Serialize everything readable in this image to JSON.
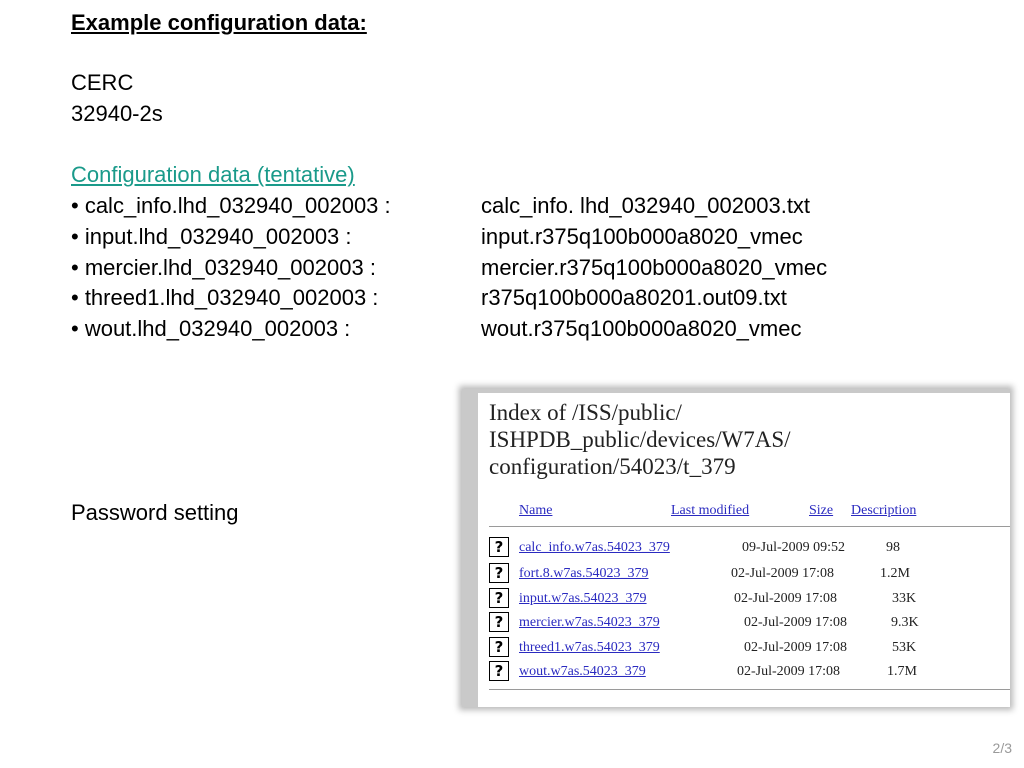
{
  "slide": {
    "heading": "Example configuration data:",
    "line1": "CERC",
    "line2": "32940-2s",
    "config_link": "Configuration data (tentative)",
    "config_items": [
      {
        "left": "• calc_info.lhd_032940_002003   :",
        "right": "calc_info. lhd_032940_002003.txt"
      },
      {
        "left": "• input.lhd_032940_002003 :",
        "right": "input.r375q100b000a8020_vmec"
      },
      {
        "left": "• mercier.lhd_032940_002003 :",
        "right": "mercier.r375q100b000a8020_vmec"
      },
      {
        "left": "• threed1.lhd_032940_002003 :",
        "right": "r375q100b000a80201.out09.txt"
      },
      {
        "left": "• wout.lhd_032940_002003 :",
        "right": "wout.r375q100b000a8020_vmec"
      }
    ],
    "password_label": "Password setting",
    "page_number": "2/3"
  },
  "listing": {
    "title": "Index of /ISS/public/\nISHPDB_public/devices/W7AS/\nconfiguration/54023/t_379",
    "columns": {
      "name": "Name",
      "modified": "Last modified",
      "size": "Size",
      "description": "Description"
    },
    "files": [
      {
        "icon": "unknown-file-icon",
        "name": "calc_info.w7as.54023_379",
        "date": "09-Jul-2009 09:52",
        "size": "98"
      },
      {
        "icon": "unknown-file-icon",
        "name": "fort.8.w7as.54023_379",
        "date": "02-Jul-2009 17:08",
        "size": "1.2M"
      },
      {
        "icon": "unknown-file-icon",
        "name": "input.w7as.54023_379",
        "date": "02-Jul-2009 17:08",
        "size": "33K"
      },
      {
        "icon": "unknown-file-icon",
        "name": "mercier.w7as.54023_379",
        "date": "02-Jul-2009 17:08",
        "size": "9.3K"
      },
      {
        "icon": "unknown-file-icon",
        "name": "threed1.w7as.54023_379",
        "date": "02-Jul-2009 17:08",
        "size": "53K"
      },
      {
        "icon": "unknown-file-icon",
        "name": "wout.w7as.54023_379",
        "date": "02-Jul-2009 17:08",
        "size": "1.7M"
      }
    ]
  },
  "colors": {
    "link_teal": "#1a9a8a",
    "listing_link": "#2a2ac0",
    "page_number": "#9a9a9a"
  }
}
